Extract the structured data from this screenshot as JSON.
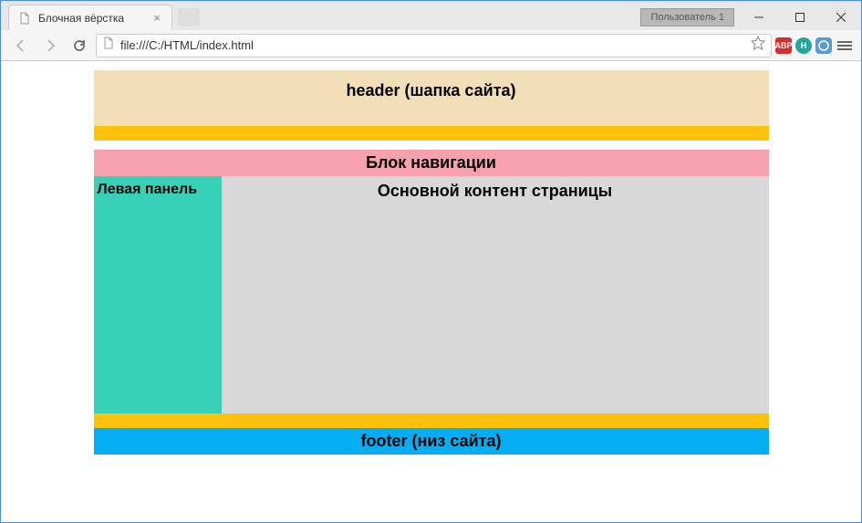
{
  "window": {
    "user_badge": "Пользователь 1"
  },
  "tab": {
    "title": "Блочная вёрстка"
  },
  "address": {
    "url": "file:///C:/HTML/index.html"
  },
  "extensions": {
    "abp": "ABP",
    "h": "H"
  },
  "page": {
    "header": "header (шапка сайта)",
    "nav": "Блок навигации",
    "left_panel": "Левая панель",
    "main_content": "Основной контент страницы",
    "footer": "footer (низ сайта)"
  }
}
